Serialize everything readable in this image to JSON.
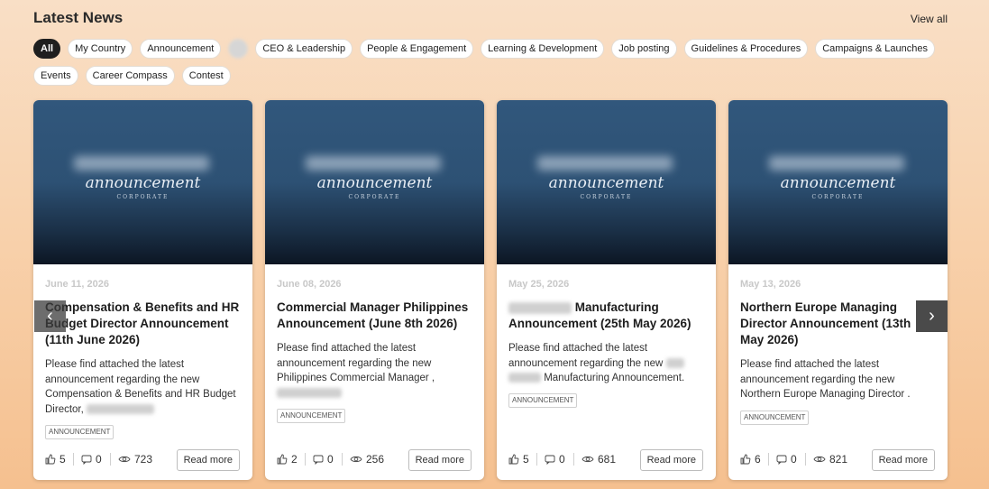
{
  "header": {
    "title": "Latest News",
    "view_all": "View all"
  },
  "filters": {
    "row1": [
      "All",
      "My Country",
      "Announcement",
      "",
      "CEO & Leadership",
      "People & Engagement",
      "Learning & Development",
      "Job posting",
      "Guidelines & Procedures",
      "Campaigns & Launches"
    ],
    "row2": [
      "Events",
      "Career Compass",
      "Contest"
    ]
  },
  "thumb": {
    "text": "announcement",
    "sub": "CORPORATE"
  },
  "cards": [
    {
      "date": "June 11, 2026",
      "title": "Compensation & Benefits and HR Budget Director Announcement (11th June 2026)",
      "desc": "Please find attached the latest announcement regarding the new Compensation & Benefits and HR Budget Director,",
      "tag": "ANNOUNCEMENT",
      "likes": "5",
      "comments": "0",
      "views": "723",
      "read_more": "Read more"
    },
    {
      "date": "June 08, 2026",
      "title": "Commercial Manager Philippines Announcement (June 8th 2026)",
      "desc": "Please find attached the latest announcement regarding the new Philippines Commercial Manager ,",
      "tag": "ANNOUNCEMENT",
      "likes": "2",
      "comments": "0",
      "views": "256",
      "read_more": "Read more"
    },
    {
      "date": "May 25, 2026",
      "title": "Manufacturing Announcement (25th May 2026)",
      "desc_a": "Please find attached the latest announcement regarding the new",
      "desc_b": "Manufacturing Announcement.",
      "tag": "ANNOUNCEMENT",
      "likes": "5",
      "comments": "0",
      "views": "681",
      "read_more": "Read more"
    },
    {
      "date": "May 13, 2026",
      "title": "Northern Europe Managing Director Announcement (13th May 2026)",
      "desc": "Please find attached the latest announcement regarding the new Northern Europe Managing Director .",
      "tag": "ANNOUNCEMENT",
      "likes": "6",
      "comments": "0",
      "views": "821",
      "read_more": "Read more"
    }
  ],
  "nav": {
    "prev": "‹",
    "next": "›"
  }
}
